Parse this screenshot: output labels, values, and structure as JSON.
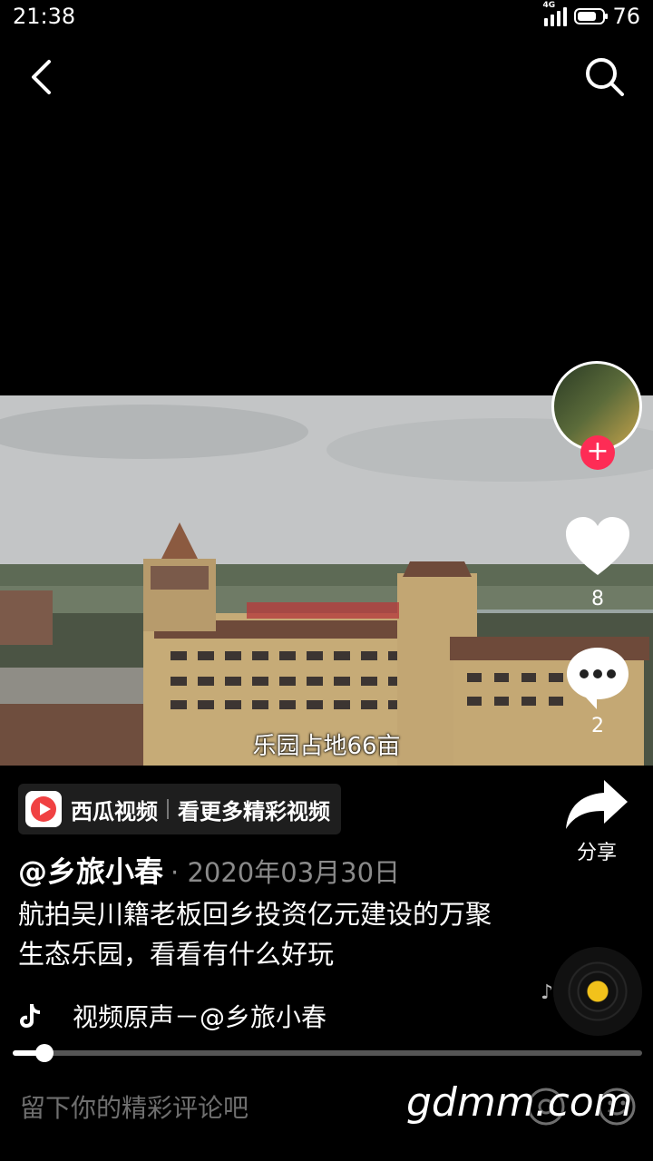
{
  "status_bar": {
    "time": "21:38",
    "network": "4G",
    "battery": "76",
    "battery_level": 0.76
  },
  "nav": {
    "back_icon": "chevron-left-icon",
    "search_icon": "search-icon"
  },
  "video": {
    "subtitle": "乐园占地66亩",
    "progress": 0.05
  },
  "side_rail": {
    "like_count": "8",
    "comment_count": "2",
    "share_label": "分享",
    "follow_icon": "+"
  },
  "xigua_banner": {
    "brand": "西瓜视频",
    "cta": "看更多精彩视频"
  },
  "post": {
    "author": "@乡旅小春",
    "date": "· 2020年03月30日",
    "caption": "航拍吴川籍老板回乡投资亿元建设的万聚生态乐园，看看有什么好玩"
  },
  "music": {
    "label": "视频原声－@乡旅小春"
  },
  "comment_bar": {
    "placeholder": "留下你的精彩评论吧"
  },
  "watermark": "gdmm.com",
  "colors": {
    "accent": "#fe2c55",
    "disc_center": "#f2c21b"
  }
}
